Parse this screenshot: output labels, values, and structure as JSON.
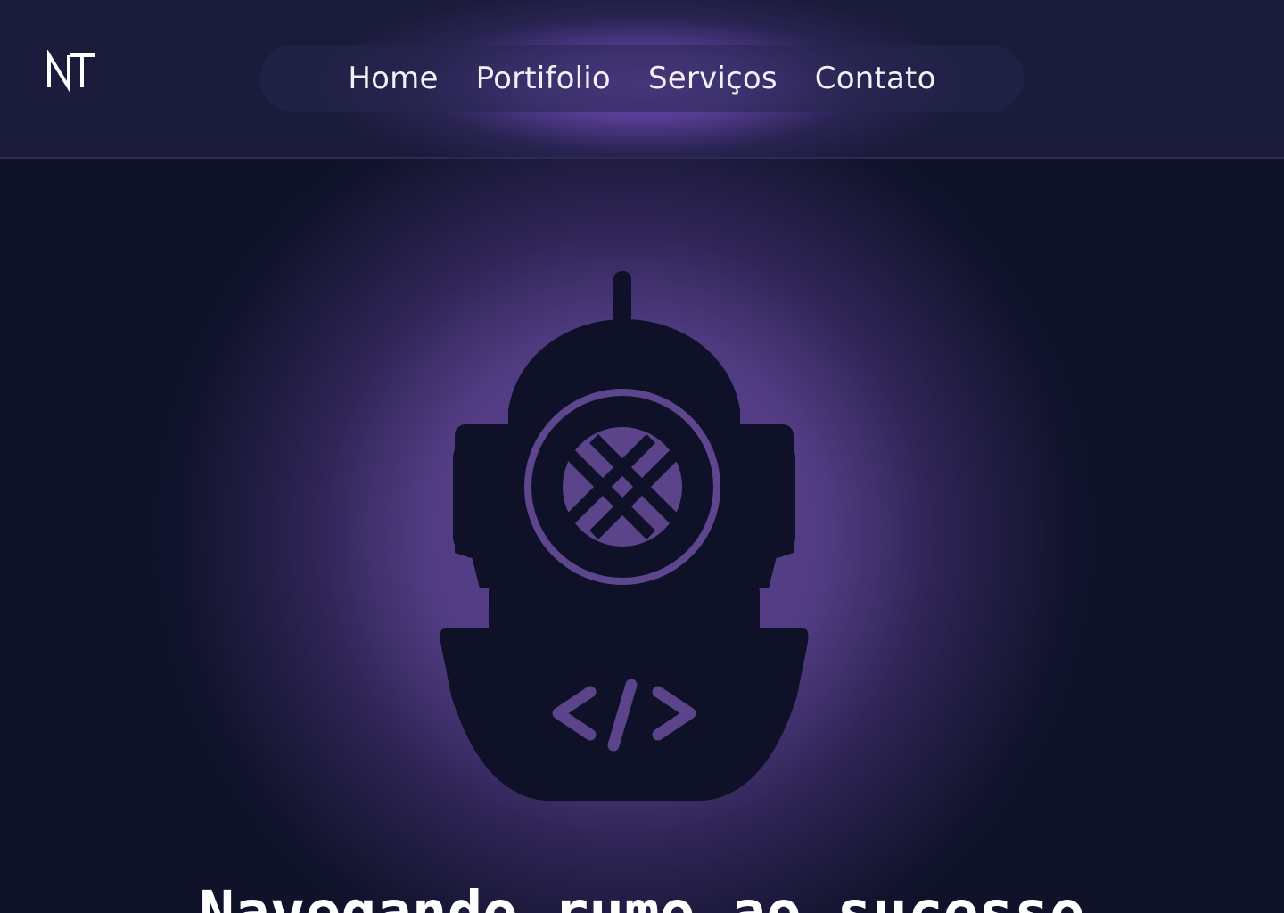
{
  "header": {
    "logo_text": "NT",
    "nav": [
      {
        "label": "Home"
      },
      {
        "label": "Portifolio"
      },
      {
        "label": "Serviços"
      },
      {
        "label": "Contato"
      }
    ]
  },
  "hero": {
    "image_icon": "diving-helmet-code-icon",
    "title": "Navegando rumo ao sucesso"
  },
  "colors": {
    "background": "#0f1229",
    "header": "#1b1c3c",
    "glow": "#6c4aaf",
    "helmet": "#0e1128",
    "text": "#ffffff"
  }
}
